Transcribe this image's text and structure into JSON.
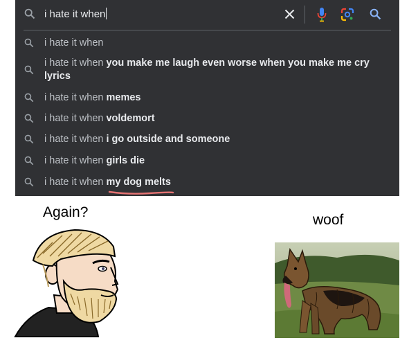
{
  "search": {
    "query": "i hate it when",
    "suggestions": [
      {
        "prefix": "i hate it when",
        "completion": ""
      },
      {
        "prefix": "i hate it when",
        "completion": "you make me laugh even worse when you make me cry lyrics"
      },
      {
        "prefix": "i hate it when",
        "completion": "memes"
      },
      {
        "prefix": "i hate it when",
        "completion": "voldemort"
      },
      {
        "prefix": "i hate it when",
        "completion": "i go outside and someone"
      },
      {
        "prefix": "i hate it when",
        "completion": "girls die"
      },
      {
        "prefix": "i hate it when",
        "completion": "my dog melts"
      }
    ],
    "icons": {
      "search": "search-icon",
      "clear": "close-icon",
      "voice": "microphone-icon",
      "lens": "google-lens-icon",
      "submit": "search-icon"
    }
  },
  "meme": {
    "left_caption": "Again?",
    "right_caption": "woof"
  },
  "colors": {
    "panel_bg": "#303134",
    "text_light": "#e8eaed",
    "text_muted": "#bdc1c6",
    "icon_blue": "#8ab4f8",
    "underline": "#e57373"
  }
}
